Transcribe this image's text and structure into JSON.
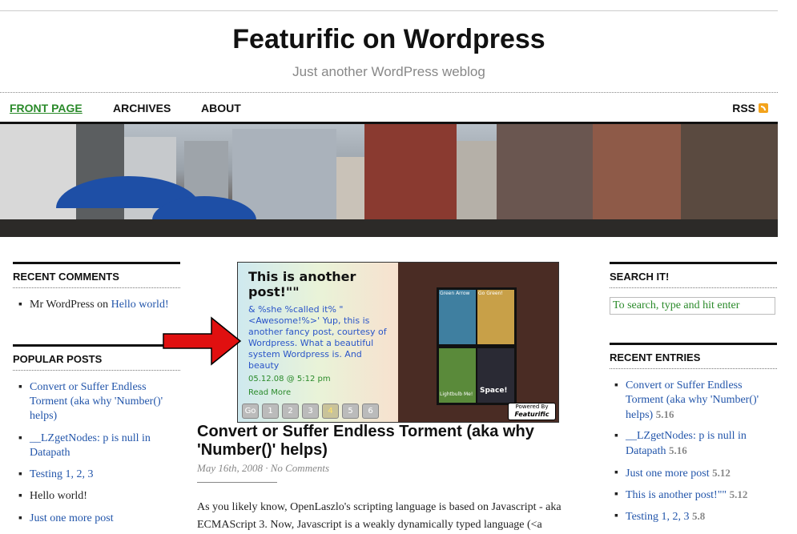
{
  "site": {
    "title": "Featurific on Wordpress",
    "description": "Just another WordPress weblog"
  },
  "nav": {
    "items": [
      "FRONT PAGE",
      "ARCHIVES",
      "ABOUT"
    ],
    "rss_label": "RSS",
    "current_color": "#2a8a2a"
  },
  "sidebar_left": {
    "recent_comments": {
      "heading": "RECENT COMMENTS",
      "items": [
        {
          "author": "Mr WordPress",
          "on": "on",
          "post": "Hello world!"
        }
      ]
    },
    "popular_posts": {
      "heading": "POPULAR POSTS",
      "items": [
        {
          "title": "Convert or Suffer Endless Torment (aka why 'Number()' helps)"
        },
        {
          "title": "__LZgetNodes: p is null in Datapath"
        },
        {
          "title": "Testing 1, 2, 3"
        },
        {
          "title": "Hello world!"
        },
        {
          "title": "Just one more post"
        }
      ]
    }
  },
  "featurific": {
    "title": "This is another post!\"\"",
    "body": "& %she %called it% \"<Awesome!%>' Yup, this is another fancy post, courtesy of Wordpress. What a beautiful system Wordpress is. And beauty",
    "date": "05.12.08 @ 5:12 pm",
    "read_more": "Read More",
    "buttons": [
      "Go",
      "1",
      "2",
      "3",
      "4",
      "5",
      "6"
    ],
    "active_button": "4",
    "powered_by": "Powered By",
    "powered_brand": "Featurific",
    "comic_captions": [
      "Green Arrow",
      "Go Green!",
      "Lightbulb Me!",
      "Space!"
    ]
  },
  "post": {
    "title": "Convert or Suffer Endless Torment (aka why 'Number()' helps)",
    "date": "May 16th, 2008",
    "separator": " · ",
    "comments": "No Comments",
    "excerpt": "As you likely know, OpenLaszlo's scripting language is based on Javascript - aka ECMAScript 3. Now, Javascript is a weakly dynamically typed language (<a"
  },
  "sidebar_right": {
    "search": {
      "heading": "SEARCH IT!",
      "placeholder": "To search, type and hit enter"
    },
    "recent_entries": {
      "heading": "RECENT ENTRIES",
      "items": [
        {
          "title": "Convert or Suffer Endless Torment (aka why 'Number()' helps)",
          "count": "5.16"
        },
        {
          "title": "__LZgetNodes: p is null in Datapath",
          "count": "5.16"
        },
        {
          "title": "Just one more post",
          "count": "5.12"
        },
        {
          "title": "This is another post!\"\"",
          "count": "5.12"
        },
        {
          "title": "Testing 1, 2, 3",
          "count": "5.8"
        }
      ]
    }
  },
  "colors": {
    "link": "#2255aa",
    "green": "#2a8a2a",
    "featurific_link": "#2a55c8",
    "rss_orange": "#f3a31c",
    "arrow_red": "#e01010"
  }
}
